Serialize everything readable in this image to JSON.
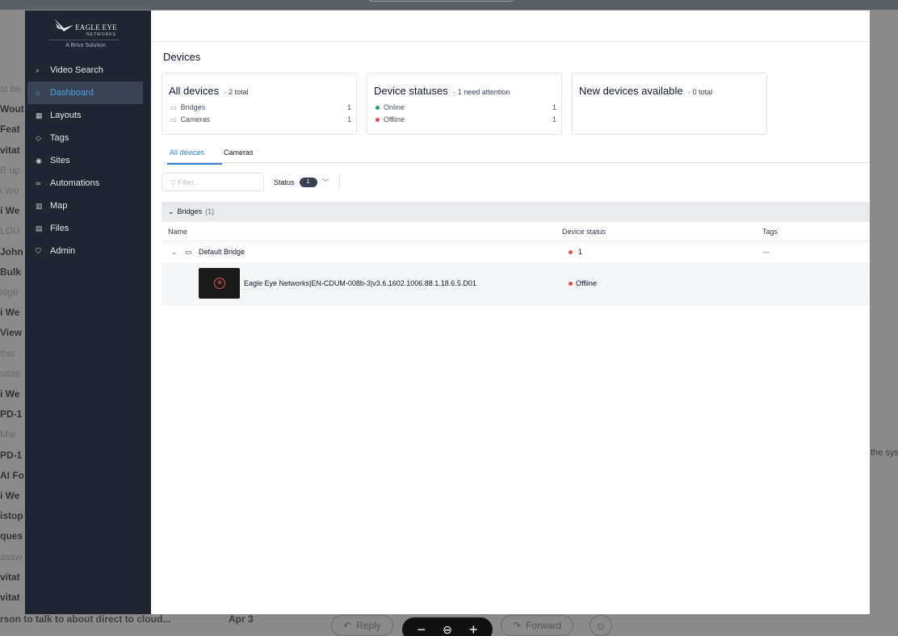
{
  "background": {
    "list_fragments": [
      {
        "text": "st be",
        "weight": "light"
      },
      {
        "text": "Wout",
        "weight": "bold"
      },
      {
        "text": "Feat",
        "weight": "bold"
      },
      {
        "text": "vitat",
        "weight": "bold"
      },
      {
        "text": "B up",
        "weight": "light"
      },
      {
        "text": "i We",
        "weight": "light"
      },
      {
        "text": "i We",
        "weight": "bold"
      },
      {
        "text": "LOU",
        "weight": "light"
      },
      {
        "text": "John",
        "weight": "bold"
      },
      {
        "text": "Bulk",
        "weight": "bold"
      },
      {
        "text": "idge",
        "weight": "light"
      },
      {
        "text": "i We",
        "weight": "bold"
      },
      {
        "text": "View",
        "weight": "bold"
      },
      {
        "text": "this",
        "weight": "light"
      },
      {
        "text": "vitati",
        "weight": "light"
      },
      {
        "text": "i We",
        "weight": "bold"
      },
      {
        "text": "PD-1",
        "weight": "bold"
      },
      {
        "text": "Mar",
        "weight": "light"
      },
      {
        "text": "PD-1",
        "weight": "bold"
      },
      {
        "text": "AI Fo",
        "weight": "bold"
      },
      {
        "text": "i We",
        "weight": "bold"
      },
      {
        "text": "istop",
        "weight": "bold"
      },
      {
        "text": "ques",
        "weight": "bold"
      },
      {
        "text": "assw",
        "weight": "light"
      },
      {
        "text": "vitat",
        "weight": "bold"
      },
      {
        "text": "vitat",
        "weight": "bold"
      }
    ],
    "bottom_subject": "rson to talk to about direct to cloud...",
    "bottom_date": "Apr 3",
    "reply_label": "Reply",
    "forward_label": "Forward",
    "right_text": "the sys",
    "zoom": {
      "minus": "−",
      "zoom_icon": "⊖",
      "plus": "+"
    }
  },
  "sidebar": {
    "brand": "EAGLE EYE",
    "brand_sub": "NETWORKS",
    "tagline": "A Brivo Solution",
    "items": [
      {
        "label": "Video Search",
        "icon": "⌕",
        "active": false
      },
      {
        "label": "Dashboard",
        "icon": "⌂",
        "active": true
      },
      {
        "label": "Layouts",
        "icon": "▦",
        "active": false
      },
      {
        "label": "Tags",
        "icon": "◇",
        "active": false
      },
      {
        "label": "Sites",
        "icon": "◉",
        "active": false
      },
      {
        "label": "Automations",
        "icon": "∞",
        "active": false
      },
      {
        "label": "Map",
        "icon": "▥",
        "active": false
      },
      {
        "label": "Files",
        "icon": "▤",
        "active": false
      },
      {
        "label": "Admin",
        "icon": "⛉",
        "active": false
      }
    ]
  },
  "main": {
    "title": "Devices",
    "cards": [
      {
        "title": "All devices",
        "sub": "2 total",
        "rows": [
          {
            "label": "Bridges",
            "value": "1",
            "icon": "▭"
          },
          {
            "label": "Cameras",
            "value": "1",
            "icon": "▭"
          }
        ]
      },
      {
        "title": "Device statuses",
        "sub": "1 need attention",
        "rows": [
          {
            "label": "Online",
            "value": "1",
            "color": "#22a06b"
          },
          {
            "label": "Offline",
            "value": "1",
            "color": "#e5484d"
          }
        ]
      },
      {
        "title": "New devices available",
        "sub": "0 total",
        "rows": []
      }
    ],
    "tabs": [
      {
        "label": "All devices",
        "active": true
      },
      {
        "label": "Cameras",
        "active": false
      }
    ],
    "filter_placeholder": "Filter...",
    "status_label": "Status",
    "status_count": "1",
    "group": {
      "label": "Bridges",
      "count": "(1)"
    },
    "columns": {
      "name": "Name",
      "status": "Device status",
      "tags": "Tags"
    },
    "bridge": {
      "name": "Default Bridge",
      "status": "1",
      "tags": "—"
    },
    "camera": {
      "name": "Eagle Eye Networks|EN-CDUM-008b-3|v3.6.1602.1006.88.1.18.6.5.D01",
      "status": "Offline"
    },
    "colors": {
      "accent": "#2f7fd1",
      "offline": "#e5484d",
      "online": "#22a06b",
      "sidebar": "#1f2531"
    }
  }
}
